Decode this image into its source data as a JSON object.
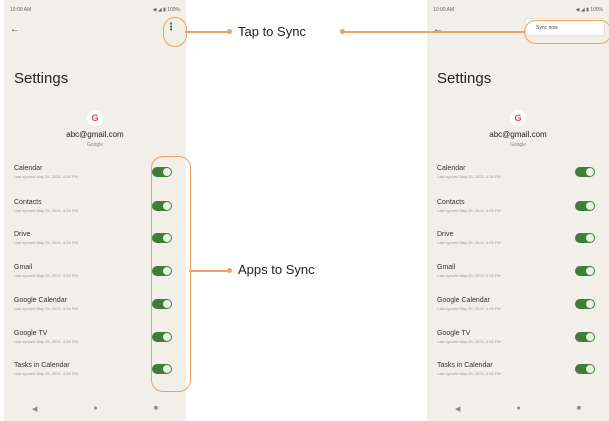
{
  "status": {
    "time": "10:00 AM",
    "icons": "◀ ◢ ▮ 100%"
  },
  "settings": {
    "title": "Settings",
    "email": "abc@gmail.com",
    "account_type": "Google"
  },
  "items": [
    {
      "name": "Calendar",
      "sub": "Last synced May 25, 2022, 4:26 PM"
    },
    {
      "name": "Contacts",
      "sub": "Last synced May 25, 2022, 4:26 PM"
    },
    {
      "name": "Drive",
      "sub": "Last synced May 25, 2022, 4:26 PM"
    },
    {
      "name": "Gmail",
      "sub": "Last synced May 25, 2022, 4:26 PM"
    },
    {
      "name": "Google Calendar",
      "sub": "Last synced May 25, 2022, 4:26 PM"
    },
    {
      "name": "Google TV",
      "sub": "Last synced May 25, 2022, 4:26 PM"
    },
    {
      "name": "Tasks in Calendar",
      "sub": "Last synced May 25, 2022, 4:26 PM"
    }
  ],
  "menu": {
    "sync_now": "Sync now"
  },
  "callouts": {
    "tap_to_sync": "Tap to Sync",
    "apps_to_sync": "Apps to Sync"
  },
  "icons": {
    "back": "←",
    "more": "⋮",
    "google": "G",
    "nav_back": "◀",
    "nav_home": "●",
    "nav_recents": "■"
  }
}
